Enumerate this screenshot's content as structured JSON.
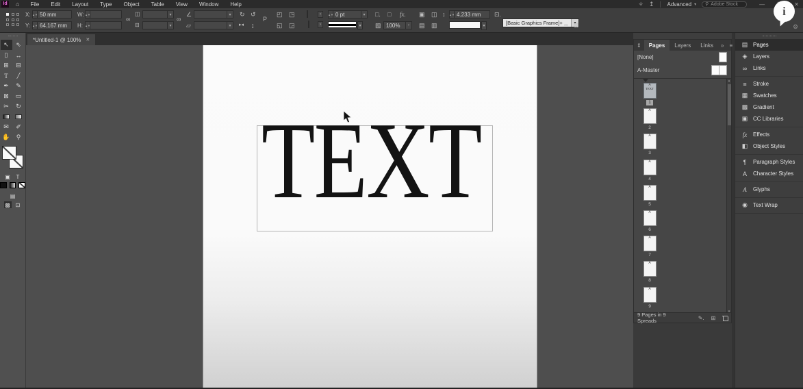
{
  "menubar": {
    "logo": "Id",
    "home_icon": "⌂",
    "menus": [
      "File",
      "Edit",
      "Layout",
      "Type",
      "Object",
      "Table",
      "View",
      "Window",
      "Help"
    ],
    "tips_icon": "✧",
    "publish_icon": "↥",
    "workspace": "Advanced",
    "caret": "▾",
    "search_icon": "⚲",
    "search_placeholder": "Adobe Stock",
    "win_minimize": "—",
    "win_restore": "❐",
    "win_close": "✕"
  },
  "control_panel": {
    "x_label": "X:",
    "x_value": "50 mm",
    "y_label": "Y:",
    "y_value": "64.167 mm",
    "w_label": "W:",
    "w_value": "",
    "h_label": "H:",
    "h_value": "",
    "constrain_icon": "∞",
    "scale_x_icon": "◫",
    "scale_y_icon": "⊟",
    "rotate_icon": "∠",
    "shear_icon": "▱",
    "rotate_cw_icon": "↻",
    "rotate_ccw_icon": "↺",
    "flip_h_icon": "▸◂",
    "flip_v_icon": "↨",
    "select_content_icon": "P",
    "fit_icons": [
      "◰",
      "◳",
      "◱",
      "◲"
    ],
    "stroke_weight": "0 pt",
    "corner_icon_1": "□.",
    "corner_icon_2": "□",
    "fx_label": "fx.",
    "transparency_icon": "▨",
    "opacity": "100%",
    "align_icons": [
      "▣",
      "◫",
      "▤",
      "▥"
    ],
    "gap_icon": "↕",
    "gap_value": "4.233 mm",
    "frame_icon": "⊡.",
    "object_style": "[Basic Graphics Frame]+",
    "right_icon_1": "∞",
    "right_icon_2": "▨"
  },
  "document": {
    "tab_title": "*Untitled-1 @ 100%",
    "close_icon": "✕",
    "canvas_text": "TEXT"
  },
  "toolbar": {
    "tools": [
      {
        "name": "selection-tool",
        "glyph": "↖",
        "selected": true
      },
      {
        "name": "direct-selection-tool",
        "glyph": "⇖",
        "selected": false
      },
      {
        "name": "page-tool",
        "glyph": "▯",
        "selected": false
      },
      {
        "name": "gap-tool",
        "glyph": "↔",
        "selected": false
      },
      {
        "name": "content-collector-tool",
        "glyph": "⊞",
        "selected": false
      },
      {
        "name": "content-placer-tool",
        "glyph": "⊟",
        "selected": false
      },
      {
        "name": "type-tool",
        "glyph": "T",
        "selected": false
      },
      {
        "name": "line-tool",
        "glyph": "╱",
        "selected": false
      },
      {
        "name": "pen-tool",
        "glyph": "✒",
        "selected": false
      },
      {
        "name": "pencil-tool",
        "glyph": "✎",
        "selected": false
      },
      {
        "name": "frame-tool",
        "glyph": "⊠",
        "selected": false
      },
      {
        "name": "rectangle-tool",
        "glyph": "▭",
        "selected": false
      },
      {
        "name": "scissors-tool",
        "glyph": "✂",
        "selected": false
      },
      {
        "name": "free-transform-tool",
        "glyph": "↻",
        "selected": false
      },
      {
        "name": "gradient-swatch-tool",
        "glyph": "",
        "selected": false
      },
      {
        "name": "gradient-feather-tool",
        "glyph": "",
        "selected": false
      },
      {
        "name": "note-tool",
        "glyph": "✉",
        "selected": false
      },
      {
        "name": "eyedropper-tool",
        "glyph": "✐",
        "selected": false
      },
      {
        "name": "hand-tool",
        "glyph": "✋",
        "selected": false
      },
      {
        "name": "zoom-tool",
        "glyph": "⚲",
        "selected": false
      }
    ],
    "container_icon": "▣",
    "text_icon": "T"
  },
  "pages_panel": {
    "collapse_icon": "⇕",
    "tabs": [
      {
        "label": "Pages",
        "active": true
      },
      {
        "label": "Layers",
        "active": false
      },
      {
        "label": "Links",
        "active": false
      }
    ],
    "double_chevron": "»",
    "menu_icon": "≡",
    "masters": [
      {
        "label": "[None]",
        "pages": 1
      },
      {
        "label": "A-Master",
        "pages": 2
      }
    ],
    "master_prefix": "A",
    "pages": [
      {
        "num": "1",
        "selected": true,
        "content": "TEXT"
      },
      {
        "num": "2",
        "selected": false,
        "content": ""
      },
      {
        "num": "3",
        "selected": false,
        "content": ""
      },
      {
        "num": "4",
        "selected": false,
        "content": ""
      },
      {
        "num": "5",
        "selected": false,
        "content": ""
      },
      {
        "num": "6",
        "selected": false,
        "content": ""
      },
      {
        "num": "7",
        "selected": false,
        "content": ""
      },
      {
        "num": "8",
        "selected": false,
        "content": ""
      },
      {
        "num": "9",
        "selected": false,
        "content": ""
      }
    ],
    "scroll_up_icon": "▴",
    "scroll_down_icon": "▾",
    "footer_summary": "9 Pages in 9 Spreads",
    "edit_size_icon": "✎.",
    "new_page_icon": "⊞"
  },
  "dock": {
    "groups": [
      [
        {
          "name": "pages",
          "label": "Pages",
          "icon": "▤",
          "active": true
        },
        {
          "name": "layers",
          "label": "Layers",
          "icon": "◈",
          "active": false
        },
        {
          "name": "links",
          "label": "Links",
          "icon": "∞",
          "active": false
        }
      ],
      [
        {
          "name": "stroke",
          "label": "Stroke",
          "icon": "≡",
          "active": false
        },
        {
          "name": "swatches",
          "label": "Swatches",
          "icon": "▦",
          "active": false
        },
        {
          "name": "gradient",
          "label": "Gradient",
          "icon": "▩",
          "active": false
        },
        {
          "name": "cc-libraries",
          "label": "CC Libraries",
          "icon": "▣",
          "active": false
        }
      ],
      [
        {
          "name": "effects",
          "label": "Effects",
          "icon": "fx",
          "active": false
        },
        {
          "name": "object-styles",
          "label": "Object Styles",
          "icon": "◧",
          "active": false
        }
      ],
      [
        {
          "name": "paragraph-styles",
          "label": "Paragraph Styles",
          "icon": "¶",
          "active": false
        },
        {
          "name": "character-styles",
          "label": "Character Styles",
          "icon": "A",
          "active": false
        }
      ],
      [
        {
          "name": "glyphs",
          "label": "Glyphs",
          "icon": "A",
          "active": false
        }
      ],
      [
        {
          "name": "text-wrap",
          "label": "Text Wrap",
          "icon": "◉",
          "active": false
        }
      ]
    ]
  },
  "overlay": {
    "info": "i",
    "gear_icon": "⚙"
  }
}
